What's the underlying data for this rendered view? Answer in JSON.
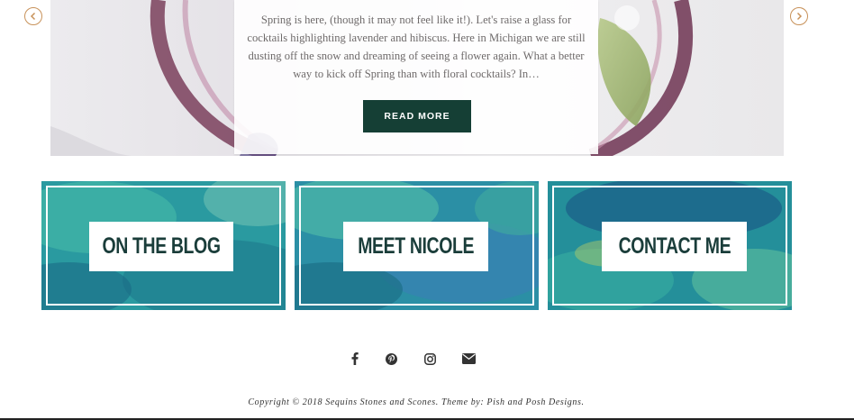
{
  "slider": {
    "excerpt": "Spring is here, (though it may not feel like it!).  Let's raise a glass for cocktails highlighting lavender and hibiscus. Here in Michigan we are still dusting off the snow and dreaming of seeing a flower again.  What a better way to kick off Spring than with floral cocktails? In…",
    "read_more_label": "READ MORE",
    "prev_icon": "chevron-left-circle",
    "next_icon": "chevron-right-circle",
    "accent_color": "#c8925a",
    "button_color": "#153f35"
  },
  "promo_tiles": [
    {
      "label": "ON THE BLOG"
    },
    {
      "label": "MEET NICOLE"
    },
    {
      "label": "CONTACT ME"
    }
  ],
  "social": {
    "icons": [
      "facebook-icon",
      "pinterest-icon",
      "instagram-icon",
      "mail-icon"
    ]
  },
  "footer": {
    "copyright": "Copyright © 2018 Sequins Stones and Scones. Theme by: Pish and Posh Designs."
  }
}
